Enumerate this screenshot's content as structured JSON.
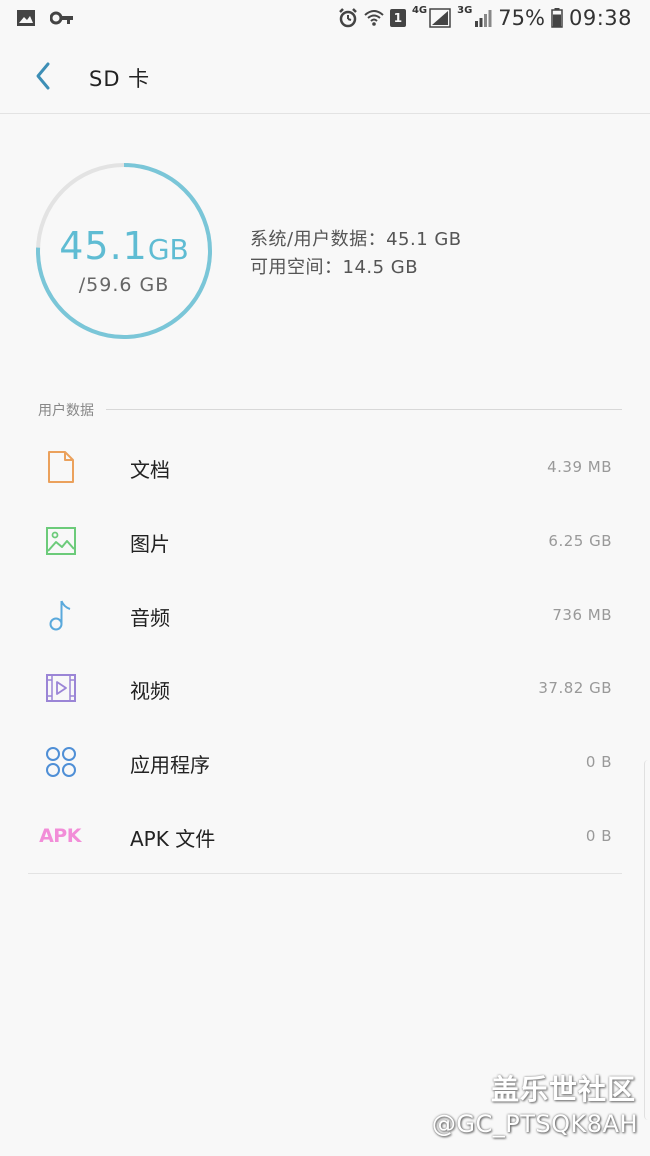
{
  "status_bar": {
    "net_4g": "4G",
    "net_3g": "3G",
    "sim_slot": "1",
    "battery": "75%",
    "time": "09:38"
  },
  "app_bar": {
    "title": "SD 卡"
  },
  "storage": {
    "used_value": "45.1",
    "used_unit": "GB",
    "total": "/59.6 GB",
    "used_fraction": 0.756,
    "system_user_data": "系统/用户数据：45.1 GB",
    "available": "可用空间：14.5 GB"
  },
  "section": {
    "label": "用户数据"
  },
  "categories": [
    {
      "label": "文档",
      "size": "4.39 MB",
      "icon": "document-icon",
      "color": "#eba15c"
    },
    {
      "label": "图片",
      "size": "6.25 GB",
      "icon": "image-icon",
      "color": "#6ccb7a"
    },
    {
      "label": "音频",
      "size": "736 MB",
      "icon": "music-note-icon",
      "color": "#5aa9dc"
    },
    {
      "label": "视频",
      "size": "37.82 GB",
      "icon": "video-icon",
      "color": "#9b85d6"
    },
    {
      "label": "应用程序",
      "size": "0 B",
      "icon": "apps-icon",
      "color": "#4f8fd6"
    },
    {
      "label": "APK 文件",
      "size": "0 B",
      "icon": "apk-icon",
      "icon_text": "APK",
      "color": "#f28dd8"
    }
  ],
  "watermark": {
    "brand": "盖乐世社区",
    "handle": "@GC_PTSQK8AH"
  },
  "colors": {
    "ring_used": "#7ac6d8",
    "ring_free": "#e3e3e3",
    "accent": "#3d8fb6"
  }
}
